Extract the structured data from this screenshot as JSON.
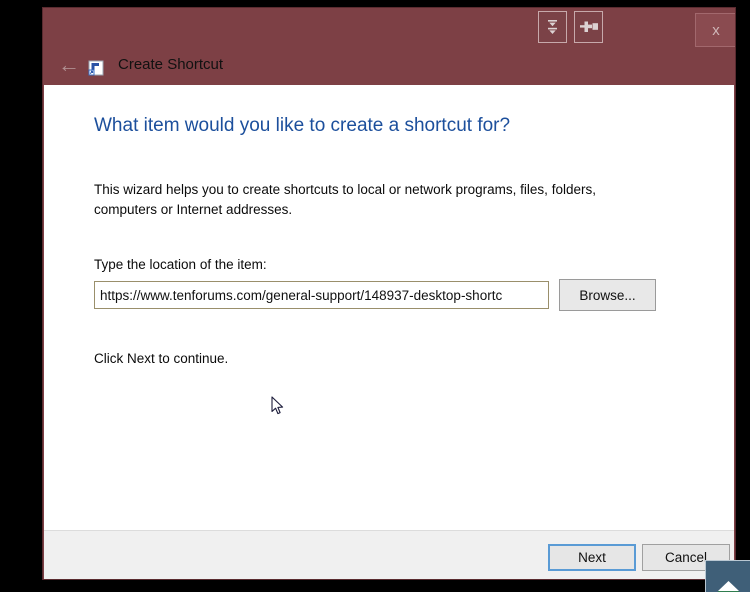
{
  "window": {
    "title": "Create Shortcut",
    "title_icon": "shortcut-icon",
    "back_arrow": "←",
    "close_label": "x",
    "accent_titlebar_color": "#7d4045",
    "extra_buttons": [
      {
        "name": "collapse-arrows-icon",
        "label": ""
      },
      {
        "name": "dock-right-icon",
        "label": ""
      }
    ]
  },
  "main": {
    "heading": "What item would you like to create a shortcut for?",
    "description": "This wizard helps you to create shortcuts to local or network programs, files, folders, computers or Internet addresses.",
    "field_label": "Type the location of the item:",
    "location_value": "https://www.tenforums.com/general-support/148937-desktop-shortc",
    "location_placeholder": "",
    "browse_label": "Browse...",
    "click_next": "Click Next to continue.",
    "heading_color": "#1c4f9c"
  },
  "footer": {
    "next_label": "Next",
    "cancel_label": "Cancel",
    "focus_color": "#5a9bd5"
  },
  "overlay": {
    "tray_icon": "taskbar-peek-icon"
  }
}
